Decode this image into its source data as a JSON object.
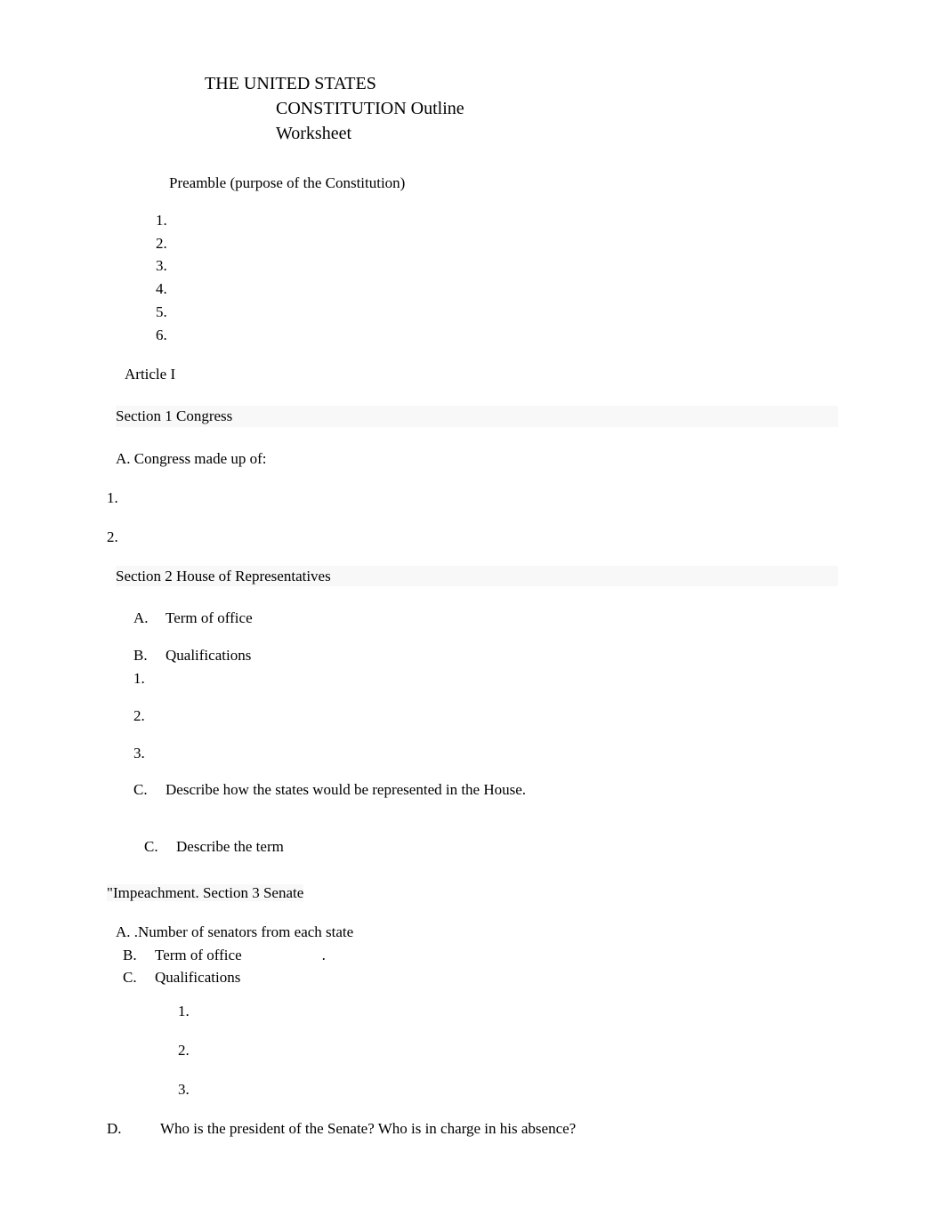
{
  "title": {
    "line1": "THE UNITED STATES",
    "line2": "CONSTITUTION Outline",
    "line3": "Worksheet"
  },
  "preamble": {
    "header": "Preamble (purpose of the Constitution)",
    "items": [
      "1.",
      "2.",
      "3.",
      "4.",
      "5.",
      "6."
    ]
  },
  "article1": {
    "label": "Article I"
  },
  "section1": {
    "heading": "Section 1 Congress",
    "subA": "A. Congress made up of:",
    "num1": "1.",
    "num2": "2."
  },
  "section2": {
    "heading": "Section 2 House of Representatives",
    "itemA": {
      "letter": "A.",
      "text": "Term of office"
    },
    "itemB": {
      "letter": "B.",
      "text": "Qualifications"
    },
    "b_nums": {
      "n1": "1.",
      "n2": "2.",
      "n3": "3."
    },
    "itemC": {
      "letter": "C.",
      "text": "Describe how the states would be represented in the House."
    },
    "itemC2": {
      "letter": "C.",
      "text": "Describe the term"
    }
  },
  "section3": {
    "heading": "\"Impeachment. Section 3 Senate",
    "itemA": "A. .Number of senators from each state",
    "itemB": {
      "letter": "B.",
      "text": "Term of office",
      "dot": "."
    },
    "itemC": {
      "letter": "C.",
      "text": "Qualifications"
    },
    "nums": {
      "n1": "1.",
      "n2": "2.",
      "n3": "3."
    },
    "itemD": {
      "letter": "D.",
      "text": "Who is the president of the Senate? Who is in charge in his absence?"
    }
  }
}
